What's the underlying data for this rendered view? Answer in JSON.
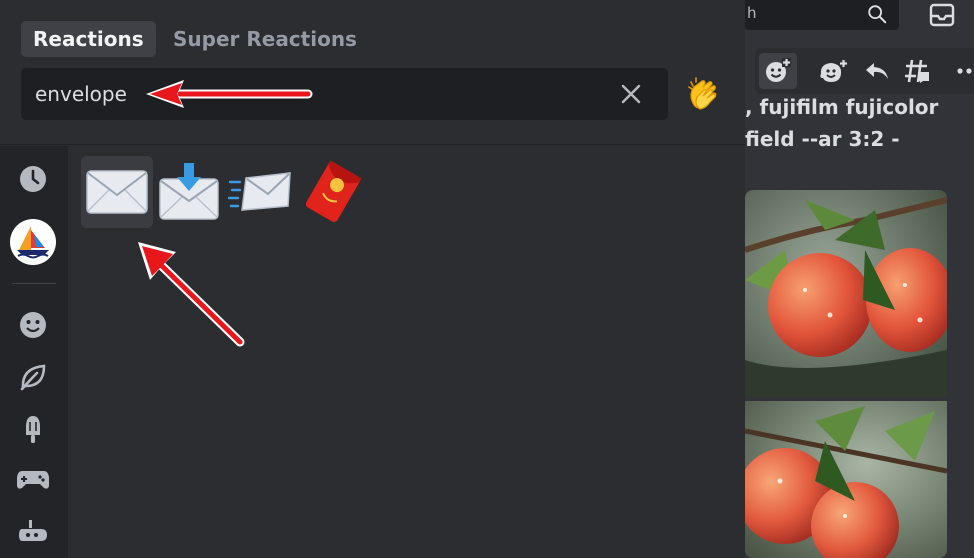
{
  "picker": {
    "tabs": [
      {
        "label": "Reactions",
        "active": true
      },
      {
        "label": "Super Reactions",
        "active": false
      }
    ],
    "search": {
      "value": "envelope"
    },
    "results": [
      {
        "name": "envelope",
        "selected": true
      },
      {
        "name": "envelope_with_arrow",
        "selected": false
      },
      {
        "name": "incoming_envelope",
        "selected": false
      },
      {
        "name": "red_envelope",
        "selected": false
      }
    ],
    "categories": [
      "recent-clock-icon",
      "server-sailboat-icon",
      "people-smiley-icon",
      "nature-leaf-icon",
      "food-popsicle-icon",
      "activities-gamepad-icon",
      "travel-submarine-icon"
    ],
    "skin_tone_button": "clap-emoji"
  },
  "channel": {
    "search_fragment": "h",
    "message_lines": [
      ", fujifilm fujicolor",
      "field --ar 3:2 -"
    ]
  },
  "colors": {
    "accent_red": "#e8171b",
    "picker_bg": "#2b2d31",
    "sidebar_bg": "#232428"
  }
}
